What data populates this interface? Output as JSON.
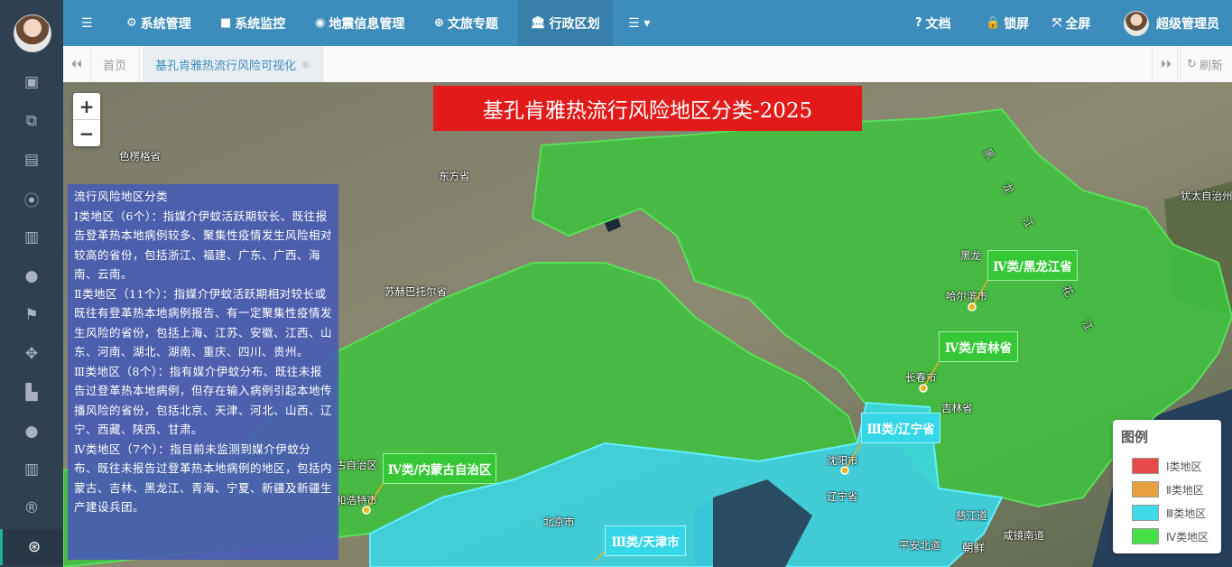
{
  "nav": {
    "items": [
      {
        "label": "系统管理",
        "icon": "gear-icon",
        "glyph": "⚙"
      },
      {
        "label": "系统监控",
        "icon": "video-camera-icon",
        "glyph": "■"
      },
      {
        "label": "地震信息管理",
        "icon": "map-marker-icon",
        "glyph": "◉"
      },
      {
        "label": "文旅专题",
        "icon": "life-ring-icon",
        "glyph": "⊕"
      },
      {
        "label": "行政区划",
        "icon": "bank-icon",
        "glyph": "🏛"
      }
    ],
    "more_glyph": "☰ ▾",
    "docs": "文档",
    "lock": "锁屏",
    "fullscreen": "全屏",
    "user": "超级管理员"
  },
  "tabs": {
    "home": "首页",
    "current": "基孔肯雅热流行风险可视化",
    "refresh": "刷新"
  },
  "map": {
    "title": "基孔肯雅热流行风险地区分类-2025",
    "info_title": "流行风险地区分类",
    "info": [
      "Ⅰ类地区（6个）：指媒介伊蚊活跃期较长、既往报告登革热本地病例较多、聚集性疫情发生风险相对较高的省份，包括浙江、福建、广东、广西、海南、云南。",
      "Ⅱ类地区（11个）：指媒介伊蚊活跃期相对较长或既往有登革热本地病例报告、有一定聚集性疫情发生风险的省份，包括上海、江苏、安徽、江西、山东、河南、湖北、湖南、重庆、四川、贵州。",
      "Ⅲ类地区（8个）：指有媒介伊蚊分布、既往未报告过登革热本地病例，但存在输入病例引起本地传播风险的省份，包括北京、天津、河北、山西、辽宁、西藏、陕西、甘肃。",
      "Ⅳ类地区（7个）：指目前未监测到媒介伊蚊分布、既往未报告过登革热本地病例的地区，包括内蒙古、吉林、黑龙江、青海、宁夏、新疆及新疆生产建设兵团。"
    ],
    "places": {
      "selenge": "色楞格省",
      "dornod": "东方省",
      "sukhbaatar": "苏赫巴托尔省",
      "harbin": "哈尔滨市",
      "heilong_partial": "黑龙",
      "changchun": "长春市",
      "jilin": "吉林省",
      "shenyang": "沈阳市",
      "liaoning": "辽宁省",
      "beijing": "北京市",
      "hohhot": "和浩特市",
      "nm_partial": "古自治区",
      "jewish_ao": "犹太自治州",
      "jagang": "慈江道",
      "south_pyongan": "平安北道",
      "north_korea": "朝鲜",
      "hamgyong": "咸镜南道",
      "amur": "黑 龙 江 松 花 江"
    },
    "labels": {
      "heilongjiang": "Ⅳ类/黑龙江省",
      "jilin": "Ⅳ类/吉林省",
      "liaoning": "Ⅲ类/辽宁省",
      "neimenggu": "Ⅳ类/内蒙古自治区",
      "tianjin": "Ⅲ类/天津市"
    }
  },
  "legend": {
    "title": "图例",
    "items": [
      {
        "label": "Ⅰ类地区",
        "color": "#e84a4a"
      },
      {
        "label": "Ⅱ类地区",
        "color": "#e8a040"
      },
      {
        "label": "Ⅲ类地区",
        "color": "#40dbe8"
      },
      {
        "label": "Ⅳ类地区",
        "color": "#46e046"
      }
    ]
  },
  "zoom": {
    "in": "+",
    "out": "−"
  }
}
